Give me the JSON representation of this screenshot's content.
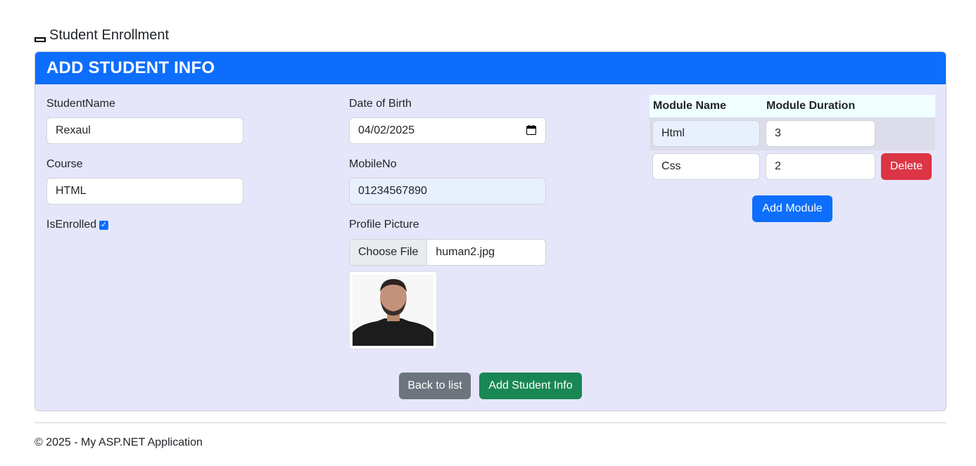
{
  "app": {
    "title": "Student Enrollment"
  },
  "card": {
    "title": "ADD STUDENT INFO"
  },
  "form": {
    "student_name": {
      "label": "StudentName",
      "value": "Rexaul"
    },
    "course": {
      "label": "Course",
      "value": "HTML"
    },
    "is_enrolled": {
      "label": "IsEnrolled",
      "checked": true
    },
    "dob": {
      "label": "Date of Birth",
      "value": "04/02/2025"
    },
    "mobile": {
      "label": "MobileNo",
      "value": "01234567890"
    },
    "profile_picture": {
      "label": "Profile Picture",
      "button": "Choose File",
      "file_name": "human2.jpg"
    }
  },
  "modules": {
    "headers": [
      "Module Name",
      "Module Duration"
    ],
    "rows": [
      {
        "name": "Html",
        "duration": "3"
      },
      {
        "name": "Css",
        "duration": "2",
        "action": "Delete"
      }
    ],
    "add_label": "Add Module"
  },
  "actions": {
    "back": "Back to list",
    "submit": "Add Student Info"
  },
  "footer": {
    "text": "© 2025 - My ASP.NET Application"
  },
  "colors": {
    "primary": "#0d6efd",
    "danger": "#dc3545",
    "success": "#198754",
    "secondary": "#6c757d",
    "card_bg": "#e6e6fa"
  }
}
